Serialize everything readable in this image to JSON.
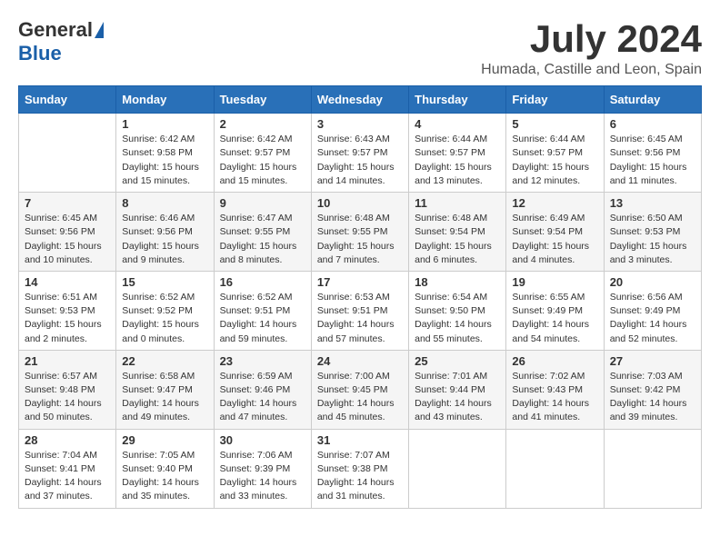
{
  "header": {
    "logo_general": "General",
    "logo_blue": "Blue",
    "month_title": "July 2024",
    "location": "Humada, Castille and Leon, Spain"
  },
  "weekdays": [
    "Sunday",
    "Monday",
    "Tuesday",
    "Wednesday",
    "Thursday",
    "Friday",
    "Saturday"
  ],
  "weeks": [
    [
      {
        "day": "",
        "sunrise": "",
        "sunset": "",
        "daylight": ""
      },
      {
        "day": "1",
        "sunrise": "Sunrise: 6:42 AM",
        "sunset": "Sunset: 9:58 PM",
        "daylight": "Daylight: 15 hours and 15 minutes."
      },
      {
        "day": "2",
        "sunrise": "Sunrise: 6:42 AM",
        "sunset": "Sunset: 9:57 PM",
        "daylight": "Daylight: 15 hours and 15 minutes."
      },
      {
        "day": "3",
        "sunrise": "Sunrise: 6:43 AM",
        "sunset": "Sunset: 9:57 PM",
        "daylight": "Daylight: 15 hours and 14 minutes."
      },
      {
        "day": "4",
        "sunrise": "Sunrise: 6:44 AM",
        "sunset": "Sunset: 9:57 PM",
        "daylight": "Daylight: 15 hours and 13 minutes."
      },
      {
        "day": "5",
        "sunrise": "Sunrise: 6:44 AM",
        "sunset": "Sunset: 9:57 PM",
        "daylight": "Daylight: 15 hours and 12 minutes."
      },
      {
        "day": "6",
        "sunrise": "Sunrise: 6:45 AM",
        "sunset": "Sunset: 9:56 PM",
        "daylight": "Daylight: 15 hours and 11 minutes."
      }
    ],
    [
      {
        "day": "7",
        "sunrise": "Sunrise: 6:45 AM",
        "sunset": "Sunset: 9:56 PM",
        "daylight": "Daylight: 15 hours and 10 minutes."
      },
      {
        "day": "8",
        "sunrise": "Sunrise: 6:46 AM",
        "sunset": "Sunset: 9:56 PM",
        "daylight": "Daylight: 15 hours and 9 minutes."
      },
      {
        "day": "9",
        "sunrise": "Sunrise: 6:47 AM",
        "sunset": "Sunset: 9:55 PM",
        "daylight": "Daylight: 15 hours and 8 minutes."
      },
      {
        "day": "10",
        "sunrise": "Sunrise: 6:48 AM",
        "sunset": "Sunset: 9:55 PM",
        "daylight": "Daylight: 15 hours and 7 minutes."
      },
      {
        "day": "11",
        "sunrise": "Sunrise: 6:48 AM",
        "sunset": "Sunset: 9:54 PM",
        "daylight": "Daylight: 15 hours and 6 minutes."
      },
      {
        "day": "12",
        "sunrise": "Sunrise: 6:49 AM",
        "sunset": "Sunset: 9:54 PM",
        "daylight": "Daylight: 15 hours and 4 minutes."
      },
      {
        "day": "13",
        "sunrise": "Sunrise: 6:50 AM",
        "sunset": "Sunset: 9:53 PM",
        "daylight": "Daylight: 15 hours and 3 minutes."
      }
    ],
    [
      {
        "day": "14",
        "sunrise": "Sunrise: 6:51 AM",
        "sunset": "Sunset: 9:53 PM",
        "daylight": "Daylight: 15 hours and 2 minutes."
      },
      {
        "day": "15",
        "sunrise": "Sunrise: 6:52 AM",
        "sunset": "Sunset: 9:52 PM",
        "daylight": "Daylight: 15 hours and 0 minutes."
      },
      {
        "day": "16",
        "sunrise": "Sunrise: 6:52 AM",
        "sunset": "Sunset: 9:51 PM",
        "daylight": "Daylight: 14 hours and 59 minutes."
      },
      {
        "day": "17",
        "sunrise": "Sunrise: 6:53 AM",
        "sunset": "Sunset: 9:51 PM",
        "daylight": "Daylight: 14 hours and 57 minutes."
      },
      {
        "day": "18",
        "sunrise": "Sunrise: 6:54 AM",
        "sunset": "Sunset: 9:50 PM",
        "daylight": "Daylight: 14 hours and 55 minutes."
      },
      {
        "day": "19",
        "sunrise": "Sunrise: 6:55 AM",
        "sunset": "Sunset: 9:49 PM",
        "daylight": "Daylight: 14 hours and 54 minutes."
      },
      {
        "day": "20",
        "sunrise": "Sunrise: 6:56 AM",
        "sunset": "Sunset: 9:49 PM",
        "daylight": "Daylight: 14 hours and 52 minutes."
      }
    ],
    [
      {
        "day": "21",
        "sunrise": "Sunrise: 6:57 AM",
        "sunset": "Sunset: 9:48 PM",
        "daylight": "Daylight: 14 hours and 50 minutes."
      },
      {
        "day": "22",
        "sunrise": "Sunrise: 6:58 AM",
        "sunset": "Sunset: 9:47 PM",
        "daylight": "Daylight: 14 hours and 49 minutes."
      },
      {
        "day": "23",
        "sunrise": "Sunrise: 6:59 AM",
        "sunset": "Sunset: 9:46 PM",
        "daylight": "Daylight: 14 hours and 47 minutes."
      },
      {
        "day": "24",
        "sunrise": "Sunrise: 7:00 AM",
        "sunset": "Sunset: 9:45 PM",
        "daylight": "Daylight: 14 hours and 45 minutes."
      },
      {
        "day": "25",
        "sunrise": "Sunrise: 7:01 AM",
        "sunset": "Sunset: 9:44 PM",
        "daylight": "Daylight: 14 hours and 43 minutes."
      },
      {
        "day": "26",
        "sunrise": "Sunrise: 7:02 AM",
        "sunset": "Sunset: 9:43 PM",
        "daylight": "Daylight: 14 hours and 41 minutes."
      },
      {
        "day": "27",
        "sunrise": "Sunrise: 7:03 AM",
        "sunset": "Sunset: 9:42 PM",
        "daylight": "Daylight: 14 hours and 39 minutes."
      }
    ],
    [
      {
        "day": "28",
        "sunrise": "Sunrise: 7:04 AM",
        "sunset": "Sunset: 9:41 PM",
        "daylight": "Daylight: 14 hours and 37 minutes."
      },
      {
        "day": "29",
        "sunrise": "Sunrise: 7:05 AM",
        "sunset": "Sunset: 9:40 PM",
        "daylight": "Daylight: 14 hours and 35 minutes."
      },
      {
        "day": "30",
        "sunrise": "Sunrise: 7:06 AM",
        "sunset": "Sunset: 9:39 PM",
        "daylight": "Daylight: 14 hours and 33 minutes."
      },
      {
        "day": "31",
        "sunrise": "Sunrise: 7:07 AM",
        "sunset": "Sunset: 9:38 PM",
        "daylight": "Daylight: 14 hours and 31 minutes."
      },
      {
        "day": "",
        "sunrise": "",
        "sunset": "",
        "daylight": ""
      },
      {
        "day": "",
        "sunrise": "",
        "sunset": "",
        "daylight": ""
      },
      {
        "day": "",
        "sunrise": "",
        "sunset": "",
        "daylight": ""
      }
    ]
  ]
}
